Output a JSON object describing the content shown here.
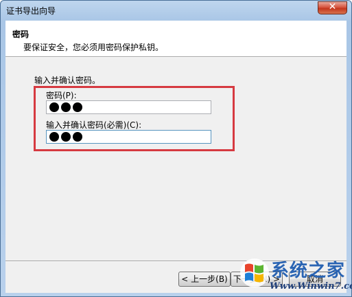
{
  "window": {
    "title": "证书导出向导",
    "close_glyph": "✕"
  },
  "header": {
    "title": "密码",
    "subtitle": "要保证安全，您必须用密码保护私钥。"
  },
  "body": {
    "instruction": "输入并确认密码。",
    "password": {
      "label": "密码(P):",
      "masked_chars": 3
    },
    "confirm": {
      "label": "输入并确认密码(必需)(C):",
      "masked_chars": 3
    }
  },
  "buttons": {
    "back": "< 上一步(B)",
    "next": "下一步(N) >",
    "cancel": "取消"
  },
  "watermark": {
    "brand": "系统之家",
    "url": "Www.Winwin7.com"
  },
  "colors": {
    "highlight_border": "#d63a41",
    "window_frame": "#a9c6e6",
    "close_button": "#c3371d"
  }
}
